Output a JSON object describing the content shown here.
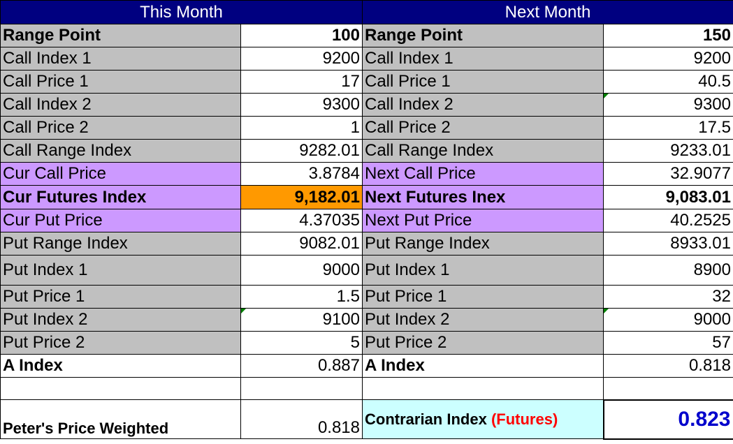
{
  "headers": {
    "this_month": "This Month",
    "next_month": "Next Month"
  },
  "rows": [
    {
      "this": {
        "label": "Range Point",
        "value": "100"
      },
      "next": {
        "label": "Range Point",
        "value": "150"
      }
    },
    {
      "this": {
        "label": "Call Index 1",
        "value": "9200"
      },
      "next": {
        "label": "Call Index 1",
        "value": "9200"
      }
    },
    {
      "this": {
        "label": "Call Price 1",
        "value": "17"
      },
      "next": {
        "label": "Call Price 1",
        "value": "40.5"
      }
    },
    {
      "this": {
        "label": "Call Index 2",
        "value": "9300"
      },
      "next": {
        "label": "Call Index 2",
        "value": "9300"
      }
    },
    {
      "this": {
        "label": "Call Price 2",
        "value": "1"
      },
      "next": {
        "label": "Call Price 2",
        "value": "17.5"
      }
    },
    {
      "this": {
        "label": "Call Range Index",
        "value": "9282.01"
      },
      "next": {
        "label": "Call Range Index",
        "value": "9233.01"
      }
    },
    {
      "this": {
        "label": "Cur Call Price",
        "value": "3.8784"
      },
      "next": {
        "label": "Next Call Price",
        "value": "32.9077"
      }
    },
    {
      "this": {
        "label": "Cur Futures Index",
        "value": "9,182.01"
      },
      "next": {
        "label": "Next Futures Inex",
        "value": "9,083.01"
      }
    },
    {
      "this": {
        "label": "Cur Put Price",
        "value": "4.37035"
      },
      "next": {
        "label": "Next Put Price",
        "value": "40.2525"
      }
    },
    {
      "this": {
        "label": "Put Range Index",
        "value": "9082.01"
      },
      "next": {
        "label": "Put Range Index",
        "value": "8933.01"
      }
    },
    {
      "this": {
        "label": "Put Index 1",
        "value": "9000"
      },
      "next": {
        "label": "Put Index 1",
        "value": "8900"
      }
    },
    {
      "this": {
        "label": "Put Price 1",
        "value": "1.5"
      },
      "next": {
        "label": "Put Price 1",
        "value": "32"
      }
    },
    {
      "this": {
        "label": "Put Index 2",
        "value": "9100"
      },
      "next": {
        "label": "Put Index 2",
        "value": "9000"
      }
    },
    {
      "this": {
        "label": "Put Price 2",
        "value": "5"
      },
      "next": {
        "label": "Put Price 2",
        "value": "57"
      }
    },
    {
      "this": {
        "label": "A Index",
        "value": "0.887"
      },
      "next": {
        "label": "A Index",
        "value": "0.818"
      }
    }
  ],
  "summary": {
    "weighted_label": "Peter's Price Weighted",
    "weighted_value": "0.818",
    "contrarian_label": "Contrarian Index",
    "contrarian_qualifier": "(Futures)",
    "contrarian_value": "0.823"
  },
  "colors": {
    "header_bg": "#000080",
    "gray_cell": "#c0c0c0",
    "purple_cell": "#cc99ff",
    "orange_cell": "#ff9900",
    "cyan_cell": "#ccffff",
    "contrarian_value": "#0000cc",
    "futures_qualifier": "#ff0000",
    "comment_marker": "#008000"
  }
}
